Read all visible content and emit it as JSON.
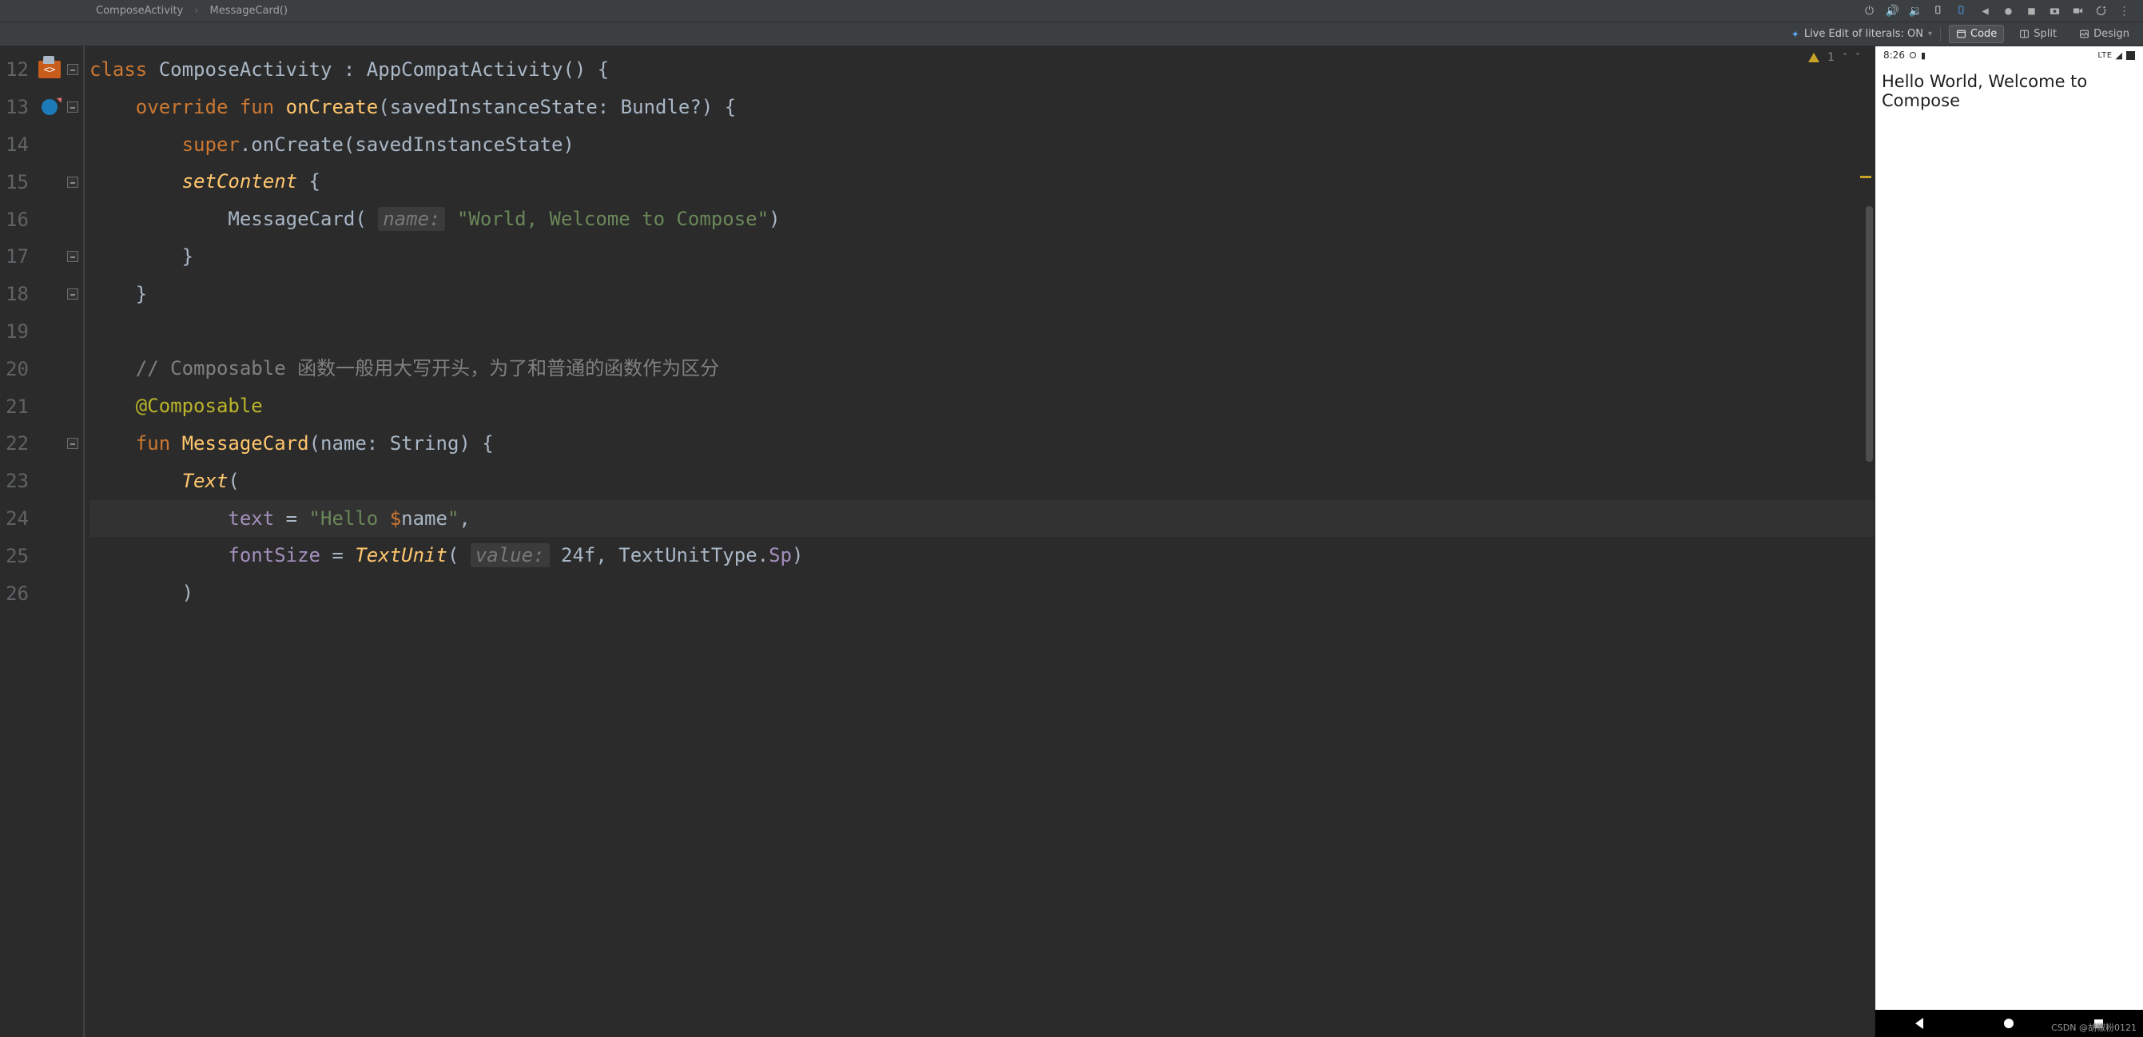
{
  "breadcrumb": {
    "file": "ComposeActivity",
    "func": "MessageCard()"
  },
  "emulator_icons": [
    "power",
    "vol-up",
    "vol-down",
    "rotate-ccw",
    "rotate-cw",
    "back",
    "circle",
    "square",
    "camera",
    "video",
    "snapshot",
    "more"
  ],
  "viewbar": {
    "live_edit_label": "Live Edit of literals: ON",
    "code": "Code",
    "split": "Split",
    "design": "Design"
  },
  "inspection": {
    "warn_count": "1"
  },
  "gutter": {
    "start": 12,
    "end": 26
  },
  "code": {
    "l12": {
      "kw": "class",
      "name": "ComposeActivity",
      "rest1": " : AppCompatActivity() {"
    },
    "l13": {
      "kw1": "override",
      "kw2": "fun",
      "fn": "onCreate",
      "params": "(savedInstanceState: Bundle?) {"
    },
    "l14": {
      "super": "super",
      "rest": ".onCreate(savedInstanceState)"
    },
    "l15": {
      "fn": "setContent",
      "brace": " {"
    },
    "l16": {
      "call": "MessageCard(",
      "hint": "name:",
      "str": "\"World, Welcome to Compose\"",
      "close": ")"
    },
    "l17": {
      "brace": "}"
    },
    "l18": {
      "brace": "}"
    },
    "l20": {
      "cmt": "// Composable 函数一般用大写开头，为了和普通的函数作为区分"
    },
    "l21": {
      "ann": "@Composable"
    },
    "l22": {
      "kw": "fun",
      "fn": "MessageCard",
      "rest": "(name: String) {"
    },
    "l23": {
      "fn": "Text",
      "open": "("
    },
    "l24": {
      "param": "text",
      "eq": " = ",
      "s1": "\"Hello ",
      "tvar": "$",
      "tname": "name",
      "s2": "\"",
      "comma": ","
    },
    "l25": {
      "param": "fontSize",
      "eq": " = ",
      "fn": "TextUnit",
      "open": "(",
      "hint": "value:",
      "val": "24f",
      "comma": ", ",
      "type": "TextUnitType.",
      "sp": "Sp",
      "close": ")"
    },
    "l26": {
      "close": ")"
    }
  },
  "device": {
    "time": "8:26",
    "net": "LTE",
    "hello": "Hello World, Welcome to Compose"
  },
  "watermark": "CSDN @胡椒粉0121"
}
